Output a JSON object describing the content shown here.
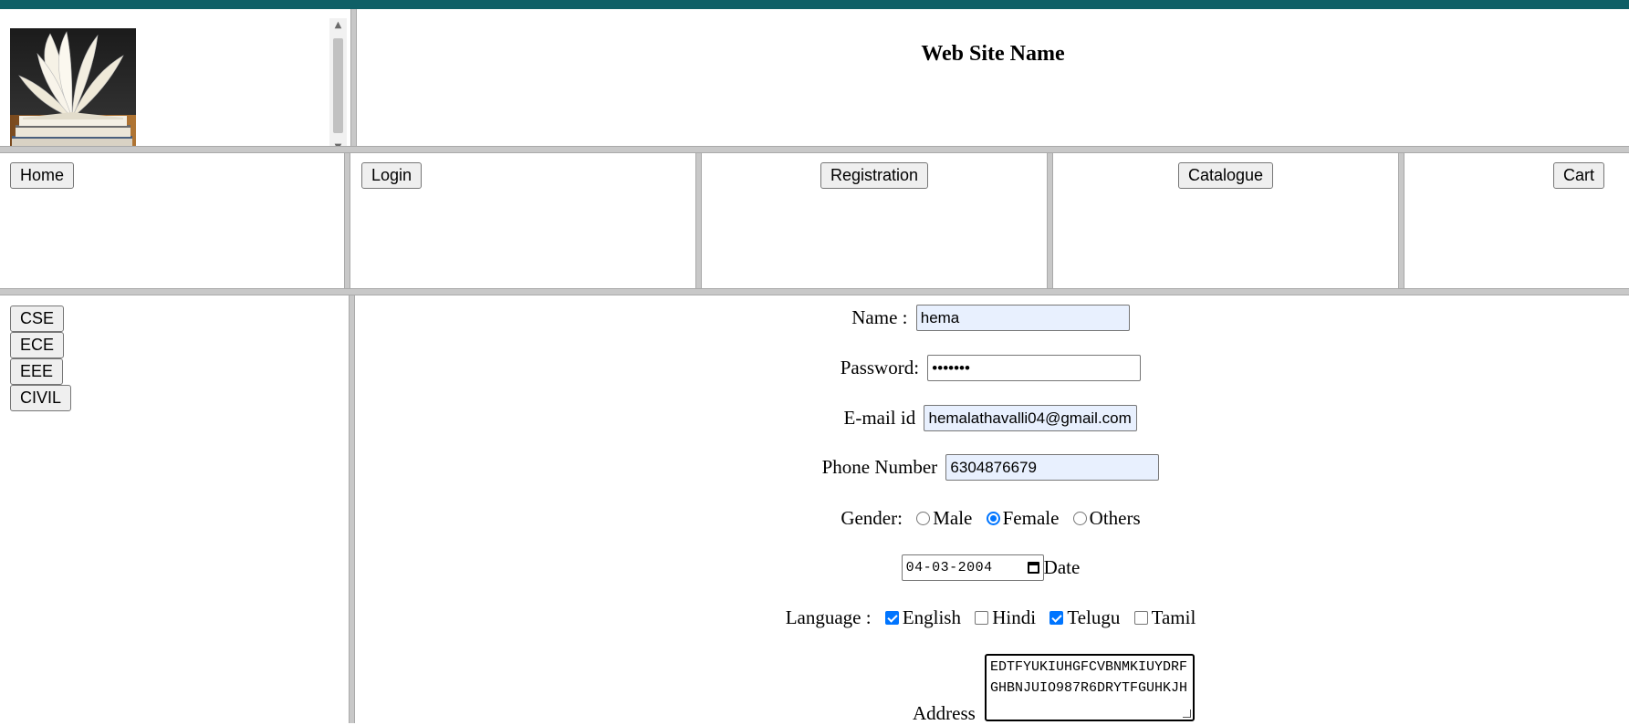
{
  "header": {
    "site_title": "Web Site Name",
    "logo": "open-book-stack"
  },
  "nav": {
    "home": "Home",
    "login": "Login",
    "registration": "Registration",
    "catalogue": "Catalogue",
    "cart": "Cart"
  },
  "sidebar": {
    "items": [
      "CSE",
      "ECE",
      "EEE",
      "CIVIL"
    ]
  },
  "form": {
    "name_label": "Name :",
    "name_value": "hema",
    "password_label": "Password:",
    "password_value": "•••••••",
    "email_label": "E-mail id",
    "email_value": "hemalathavalli04@gmail.com",
    "phone_label": "Phone Number",
    "phone_value": "6304876679",
    "gender_label": "Gender:",
    "gender_options": [
      "Male",
      "Female",
      "Others"
    ],
    "gender_selected": "Female",
    "date_value": "04-03-2004",
    "date_label": "Date",
    "language_label": "Language :",
    "language_options": [
      "English",
      "Hindi",
      "Telugu",
      "Tamil"
    ],
    "language_checked": [
      "English",
      "Telugu"
    ],
    "address_label": "Address",
    "address_value": "EDTFYUKIUHGFCVBNMKIUYDRFGHBNJUIO987R6DRYTFGUHKJH"
  },
  "colors": {
    "top_bar": "#0f5f66",
    "accent": "#0075ff",
    "autofill_bg": "#e8f0fe"
  }
}
